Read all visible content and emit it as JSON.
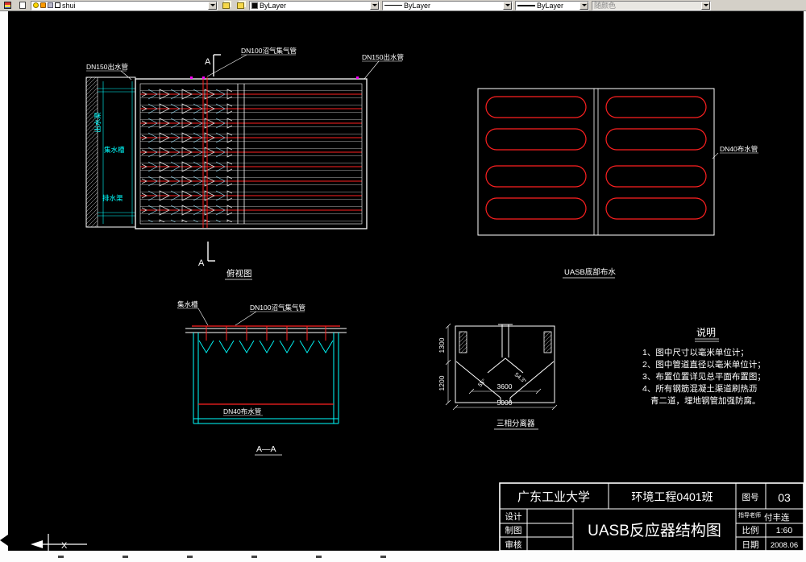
{
  "toolbar": {
    "layer": {
      "value": "shui"
    },
    "color": {
      "value": "ByLayer"
    },
    "linetype": {
      "value": "ByLayer"
    },
    "lineweight": {
      "value": "ByLayer"
    },
    "plot_style": {
      "value": "随颜色"
    }
  },
  "colors": {
    "canvas_bg": "#000000",
    "line_white": "#ffffff",
    "pipe_red": "#ff2020",
    "water_cyan": "#00ffff",
    "mark_magenta": "#ff00ff",
    "toolbar_bg": "#d4d0c8"
  },
  "plan_view": {
    "label_outlet_left": "DN150出水管",
    "label_gas_main": "DN100沼气集气管",
    "label_outlet_right": "DN150出水管",
    "section_mark": "A",
    "caption": "俯视图",
    "channel_vertical": "出水渠",
    "channel_trough": "集水槽",
    "channel_drain": "排水渠"
  },
  "distribution_view": {
    "caption": "UASB底部布水",
    "label_pipe": "DN40布水管"
  },
  "section_view": {
    "label_trough": "集水槽",
    "label_gas": "DN100沼气集气管",
    "label_pipe": "DN40布水管",
    "caption": "A—A"
  },
  "separator_view": {
    "caption": "三相分离器",
    "dim_1300": "1300",
    "dim_1200": "1200",
    "dim_3600": "3600",
    "dim_5000": "5000",
    "angle_left": "55°",
    "angle_right": "54.3°"
  },
  "notes": {
    "title": "说明",
    "lines": [
      "1、图中尺寸以毫米单位计；",
      "2、图中管道直径以毫米单位计；",
      "3、布置位置详见总平面布置图；",
      "4、所有钢筋混凝土渠道刷热沥",
      "青二道，埋地钢管加强防腐。"
    ]
  },
  "title_block": {
    "university": "广东工业大学",
    "class_name": "环境工程0401班",
    "drawing_no_label": "图号",
    "drawing_no": "03",
    "design_label": "设计",
    "draft_label": "制图",
    "review_label": "审核",
    "title": "UASB反应器结构图",
    "advisor_label": "指导老师",
    "advisor_name": "付丰连",
    "scale_label": "比例",
    "scale_value": "1:60",
    "date_label": "日期",
    "date_value": "2008.06"
  },
  "ucs": {
    "x_label": "X"
  }
}
